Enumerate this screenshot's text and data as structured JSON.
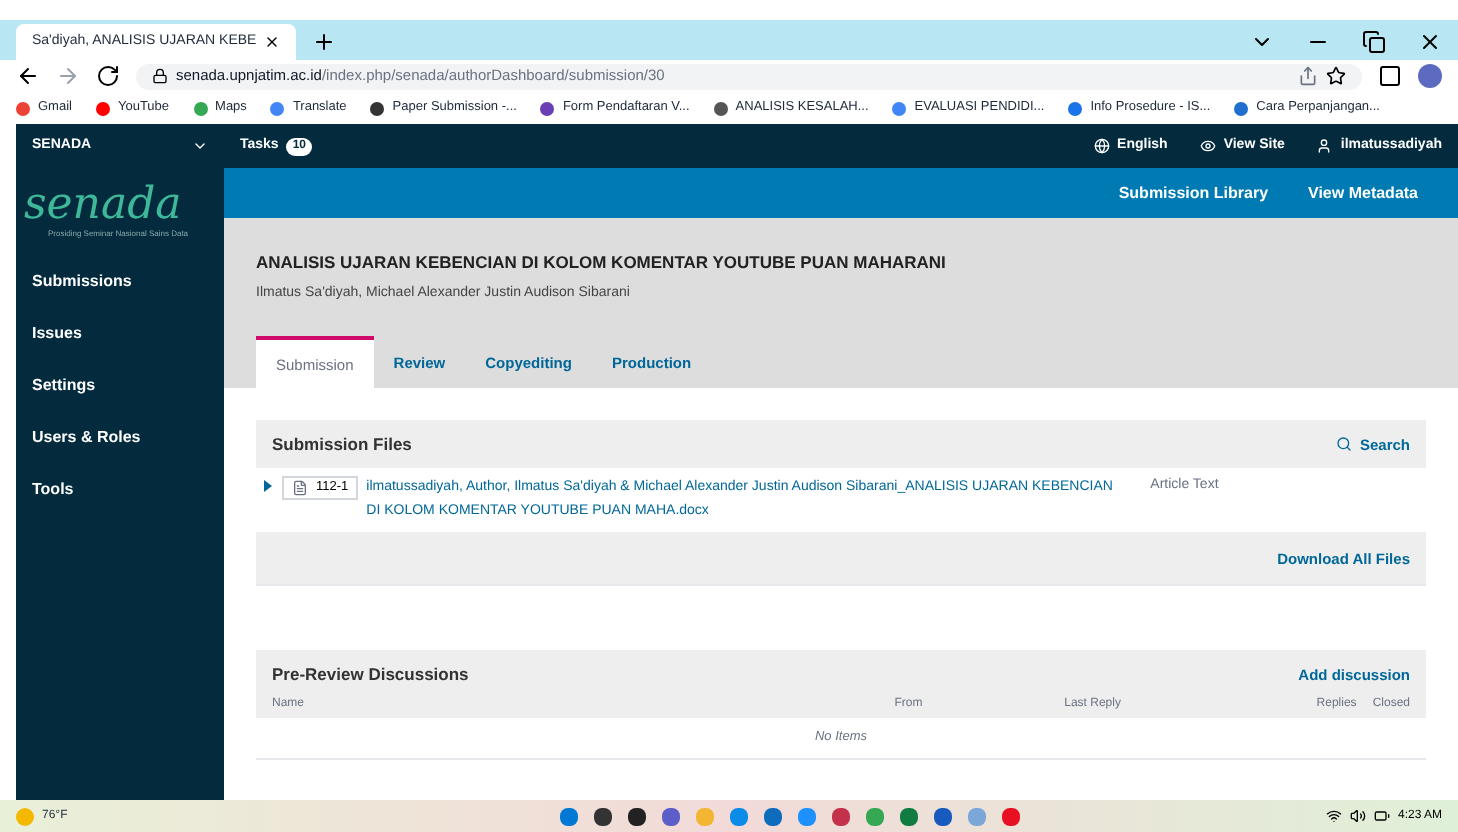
{
  "browser": {
    "tab_title": "Sa'diyah, ANALISIS UJARAN KEBE",
    "url_host": "senada.upnjatim.ac.id",
    "url_path": "/index.php/senada/authorDashboard/submission/30",
    "bookmarks": [
      "Gmail",
      "YouTube",
      "Maps",
      "Translate",
      "Paper Submission -...",
      "Form Pendaftaran V...",
      "ANALISIS KESALAH...",
      "EVALUASI PENDIDI...",
      "Info Prosedure - IS...",
      "Cara Perpanjangan..."
    ]
  },
  "topbar": {
    "context": "SENADA",
    "tasks_label": "Tasks",
    "tasks_count": "10",
    "language": "English",
    "view_site": "View Site",
    "user": "ilmatussadiyah"
  },
  "sidebar": {
    "logo": "senada",
    "logo_tagline": "Prosiding Seminar Nasional Sains Data",
    "items": [
      "Submissions",
      "Issues",
      "Settings",
      "Users & Roles",
      "Tools"
    ]
  },
  "actions": [
    "Submission Library",
    "View Metadata"
  ],
  "submission": {
    "title": "ANALISIS UJARAN KEBENCIAN DI KOLOM KOMENTAR YOUTUBE PUAN MAHARANI",
    "authors": "Ilmatus Sa'diyah, Michael Alexander Justin Audison Sibarani"
  },
  "tabs": [
    {
      "label": "Submission",
      "selected": true
    },
    {
      "label": "Review",
      "selected": false
    },
    {
      "label": "Copyediting",
      "selected": false
    },
    {
      "label": "Production",
      "selected": false
    }
  ],
  "files": {
    "heading": "Submission Files",
    "search": "Search",
    "rows": [
      {
        "id": "112-1",
        "name": "ilmatussadiyah, Author, Ilmatus Sa'diyah & Michael Alexander Justin Audison Sibarani_ANALISIS UJARAN KEBENCIAN DI KOLOM KOMENTAR YOUTUBE PUAN MAHA.docx",
        "type": "Article Text"
      }
    ],
    "download": "Download All Files"
  },
  "discussions": {
    "heading": "Pre-Review Discussions",
    "add": "Add discussion",
    "columns": [
      "Name",
      "From",
      "Last Reply",
      "Replies",
      "Closed"
    ],
    "empty": "No Items"
  },
  "taskbar": {
    "weather": "76°F",
    "time": "4:23 AM"
  }
}
